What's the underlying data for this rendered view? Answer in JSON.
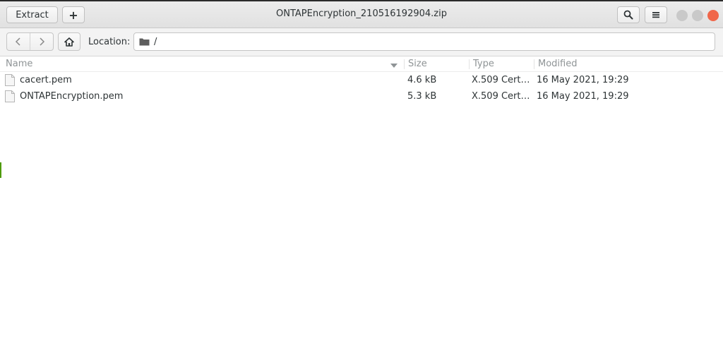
{
  "header": {
    "extract_label": "Extract",
    "add_label": "+",
    "title": "ONTAPEncryption_210516192904.zip",
    "search_icon": "search-icon",
    "menu_icon": "hamburger-menu-icon"
  },
  "location": {
    "label": "Location:",
    "path": "/",
    "folder_icon": "folder-icon"
  },
  "columns": {
    "name": "Name",
    "size": "Size",
    "type": "Type",
    "modified": "Modified"
  },
  "files": [
    {
      "name": "cacert.pem",
      "size": "4.6 kB",
      "type": "X.509 Certi…",
      "modified": "16 May 2021, 19:29"
    },
    {
      "name": "ONTAPEncryption.pem",
      "size": "5.3 kB",
      "type": "X.509 Certi…",
      "modified": "16 May 2021, 19:29"
    }
  ],
  "colors": {
    "close_button": "#f0674a",
    "window_button": "#c9c9c9",
    "header_text": "#8f9496"
  }
}
